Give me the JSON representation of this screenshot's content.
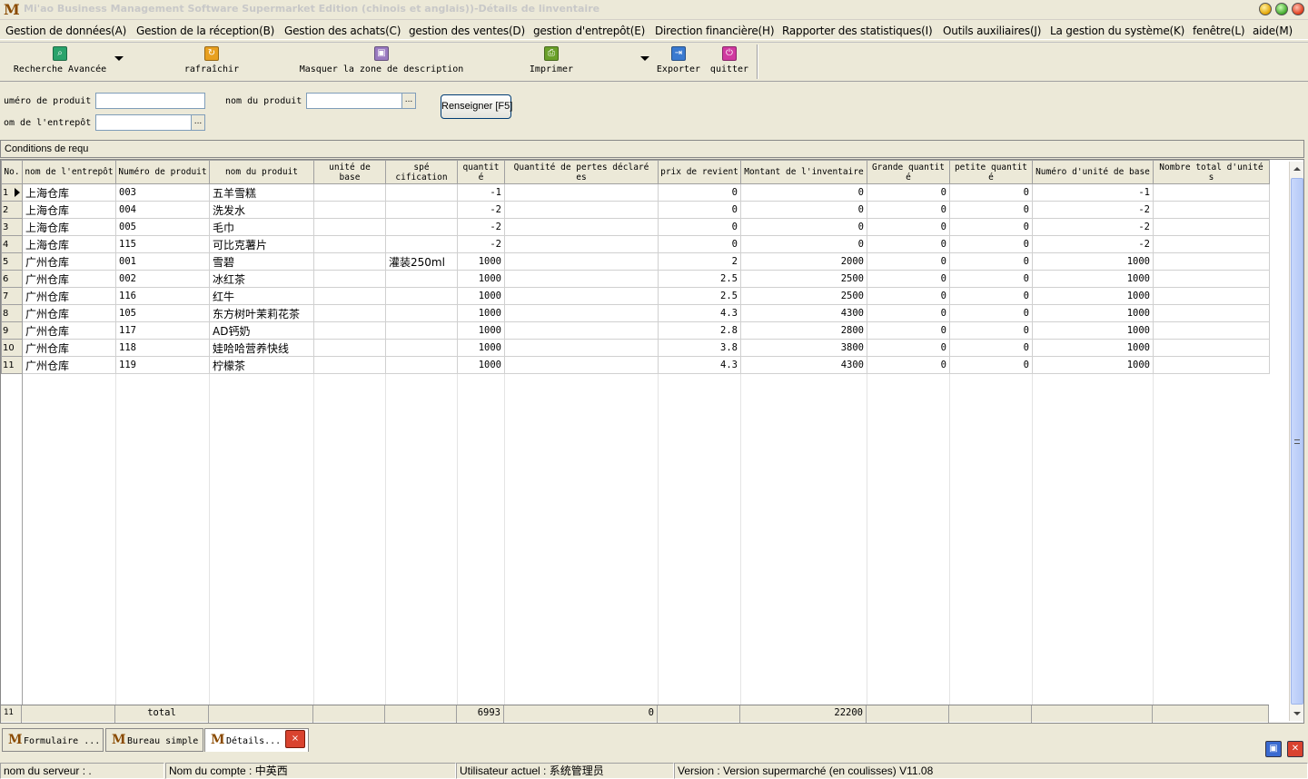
{
  "window": {
    "title": "Mi'ao Business Management Software Supermarket Edition (chinois et anglais))-Détails de linventaire",
    "logo": "M"
  },
  "menu": [
    "Gestion de données(A)",
    "Gestion de la réception(B)",
    "Gestion des achats(C)",
    "gestion des ventes(D)",
    "gestion d'entrepôt(E)",
    "Direction financière(H)",
    "Rapporter des statistiques(I)",
    "Outils auxiliaires(J)",
    "La gestion du système(K)",
    "fenêtre(L)",
    "aide(M)"
  ],
  "toolbar": {
    "advanced_search": "Recherche Avancée",
    "refresh": "rafraîchir",
    "hide_description": "Masquer la zone de description",
    "print": "Imprimer",
    "export": "Exporter",
    "quit": "quitter"
  },
  "filters": {
    "product_number_label": "uméro de produit",
    "product_name_label": "nom du produit",
    "warehouse_name_label": "om de l'entrepôt",
    "dots": "...",
    "search_button": "Renseigner [F5]",
    "conditions_label": "Conditions de requ"
  },
  "table": {
    "columns": [
      "No.",
      "nom de l'entrepôt",
      "Numéro de produit",
      "nom du produit",
      "unité de base",
      "spé cification",
      "quantit é",
      "Quantité de pertes déclaré es",
      "prix de revient",
      "Montant de l'inventaire",
      "Grande quantit é",
      "petite quantit é",
      "Numéro d'unité de base",
      "Nombre total d'unité s"
    ],
    "rows": [
      {
        "no": "1",
        "warehouse": "上海仓库",
        "code": "003",
        "name": "五羊雪糕",
        "unit": "",
        "spec": "",
        "qty": "-1",
        "loss": "",
        "cost": "0",
        "amount": "0",
        "big": "0",
        "small": "0",
        "base_num": "-1",
        "total_units": ""
      },
      {
        "no": "2",
        "warehouse": "上海仓库",
        "code": "004",
        "name": "洗发水",
        "unit": "",
        "spec": "",
        "qty": "-2",
        "loss": "",
        "cost": "0",
        "amount": "0",
        "big": "0",
        "small": "0",
        "base_num": "-2",
        "total_units": ""
      },
      {
        "no": "3",
        "warehouse": "上海仓库",
        "code": "005",
        "name": "毛巾",
        "unit": "",
        "spec": "",
        "qty": "-2",
        "loss": "",
        "cost": "0",
        "amount": "0",
        "big": "0",
        "small": "0",
        "base_num": "-2",
        "total_units": ""
      },
      {
        "no": "4",
        "warehouse": "上海仓库",
        "code": "115",
        "name": "可比克薯片",
        "unit": "",
        "spec": "",
        "qty": "-2",
        "loss": "",
        "cost": "0",
        "amount": "0",
        "big": "0",
        "small": "0",
        "base_num": "-2",
        "total_units": ""
      },
      {
        "no": "5",
        "warehouse": "广州仓库",
        "code": "001",
        "name": "雪碧",
        "unit": "",
        "spec": "灌装250ml",
        "qty": "1000",
        "loss": "",
        "cost": "2",
        "amount": "2000",
        "big": "0",
        "small": "0",
        "base_num": "1000",
        "total_units": ""
      },
      {
        "no": "6",
        "warehouse": "广州仓库",
        "code": "002",
        "name": "冰红茶",
        "unit": "",
        "spec": "",
        "qty": "1000",
        "loss": "",
        "cost": "2.5",
        "amount": "2500",
        "big": "0",
        "small": "0",
        "base_num": "1000",
        "total_units": ""
      },
      {
        "no": "7",
        "warehouse": "广州仓库",
        "code": "116",
        "name": "红牛",
        "unit": "",
        "spec": "",
        "qty": "1000",
        "loss": "",
        "cost": "2.5",
        "amount": "2500",
        "big": "0",
        "small": "0",
        "base_num": "1000",
        "total_units": ""
      },
      {
        "no": "8",
        "warehouse": "广州仓库",
        "code": "105",
        "name": "东方树叶茉莉花茶",
        "unit": "",
        "spec": "",
        "qty": "1000",
        "loss": "",
        "cost": "4.3",
        "amount": "4300",
        "big": "0",
        "small": "0",
        "base_num": "1000",
        "total_units": ""
      },
      {
        "no": "9",
        "warehouse": "广州仓库",
        "code": "117",
        "name": "AD钙奶",
        "unit": "",
        "spec": "",
        "qty": "1000",
        "loss": "",
        "cost": "2.8",
        "amount": "2800",
        "big": "0",
        "small": "0",
        "base_num": "1000",
        "total_units": ""
      },
      {
        "no": "10",
        "warehouse": "广州仓库",
        "code": "118",
        "name": "娃哈哈营养快线",
        "unit": "",
        "spec": "",
        "qty": "1000",
        "loss": "",
        "cost": "3.8",
        "amount": "3800",
        "big": "0",
        "small": "0",
        "base_num": "1000",
        "total_units": ""
      },
      {
        "no": "11",
        "warehouse": "广州仓库",
        "code": "119",
        "name": "柠檬茶",
        "unit": "",
        "spec": "",
        "qty": "1000",
        "loss": "",
        "cost": "4.3",
        "amount": "4300",
        "big": "0",
        "small": "0",
        "base_num": "1000",
        "total_units": ""
      }
    ],
    "footer": {
      "count": "11",
      "label": "total",
      "qty_total": "6993",
      "loss_total": "0",
      "amount_total": "22200"
    }
  },
  "tabs": [
    {
      "label": "Formulaire ..."
    },
    {
      "label": "Bureau simple"
    },
    {
      "label": "Détails..."
    }
  ],
  "tab_close": "×",
  "status": {
    "server": "nom du serveur : .",
    "account": "Nom du compte : 中英西",
    "user": "Utilisateur actuel : 系统管理员",
    "version": "Version : Version supermarché (en coulisses) V11.08"
  },
  "colors": {
    "chrome_bg": "#ece9d8",
    "search_icon": "#2aa36b",
    "refresh_icon": "#e8a020",
    "hide_icon": "#9a7ac0",
    "print_icon": "#6aa02a",
    "export_icon": "#3a7ad0",
    "quit_icon": "#d03aa0"
  }
}
